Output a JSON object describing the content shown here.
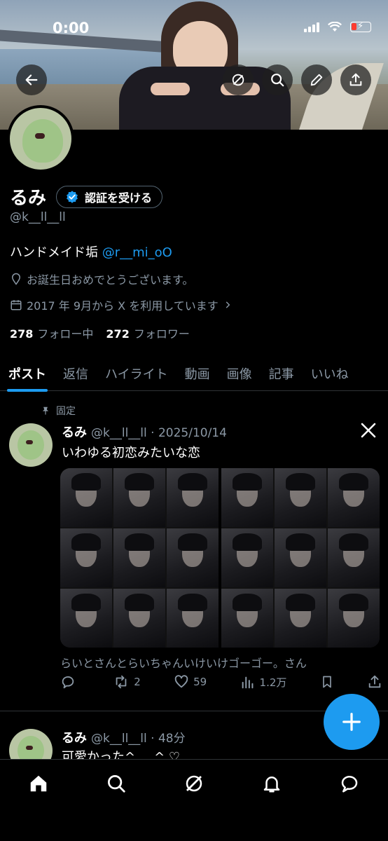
{
  "status_bar": {
    "time": "0:00"
  },
  "header_buttons": {
    "back": "back-arrow-icon",
    "grok": "grok-icon",
    "search": "search-icon",
    "edit": "edit-pencil-icon",
    "share": "share-icon"
  },
  "profile": {
    "display_name": "るみ",
    "verify_label": "認証を受ける",
    "handle": "@k__ll__ll",
    "bio_text": "ハンドメイド垢 ",
    "bio_mention": "@r__mi_oO",
    "location": "お誕生日おめでとうございます。",
    "joined": "2017 年 9月から X を利用しています",
    "following_count": "278",
    "following_label": "フォロー中",
    "followers_count": "272",
    "followers_label": "フォロワー"
  },
  "tabs": [
    {
      "label": "ポスト",
      "active": true
    },
    {
      "label": "返信"
    },
    {
      "label": "ハイライト"
    },
    {
      "label": "動画"
    },
    {
      "label": "画像"
    },
    {
      "label": "記事"
    },
    {
      "label": "いいね"
    }
  ],
  "pinned_post": {
    "pinned_label": "固定",
    "author": "るみ",
    "handle_date": "@k__ll__ll · 2025/10/14",
    "text": "いわゆる初恋みたいな恋",
    "caption": "らいとさんとらいちゃんいけいけゴーゴー。さん",
    "replies": "",
    "reposts": "2",
    "likes": "59",
    "views": "1.2万"
  },
  "second_post": {
    "author": "るみ",
    "handle_time": "@k__ll__ll · 48分",
    "text": "可愛かった^___^ ♡"
  },
  "colors": {
    "accent": "#1d9bf0",
    "background": "#000000",
    "secondary_text": "#8b98a5",
    "border": "#2f3336"
  }
}
